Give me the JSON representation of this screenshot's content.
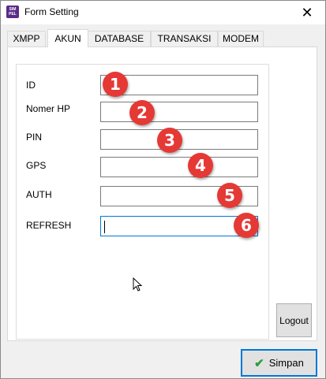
{
  "window": {
    "title": "Form Setting",
    "icon_text": "SIM PEL",
    "close_symbol": "✕"
  },
  "tabs": [
    {
      "label": "XMPP",
      "active": false
    },
    {
      "label": "AKUN",
      "active": true
    },
    {
      "label": "DATABASE",
      "active": false
    },
    {
      "label": "TRANSAKSI",
      "active": false
    },
    {
      "label": "MODEM",
      "active": false
    }
  ],
  "form": {
    "fields": [
      {
        "label": "ID",
        "value": "",
        "badge": "1"
      },
      {
        "label": "Nomer HP",
        "value": "",
        "badge": "2"
      },
      {
        "label": "PIN",
        "value": "",
        "badge": "3"
      },
      {
        "label": "GPS",
        "value": "",
        "badge": "4"
      },
      {
        "label": "AUTH",
        "value": "",
        "badge": "5"
      },
      {
        "label": "REFRESH",
        "value": "",
        "badge": "6"
      }
    ]
  },
  "buttons": {
    "logout": "Logout",
    "save": "Simpan"
  },
  "colors": {
    "badge": "#e53935",
    "focus_border": "#0078d7",
    "check_icon": "#2e9d3f"
  }
}
